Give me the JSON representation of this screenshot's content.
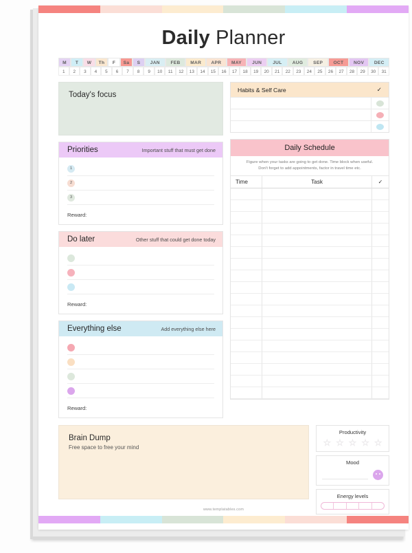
{
  "page": {
    "title_bold": "Daily",
    "title_light": " Planner",
    "footer": "www.templatables.com"
  },
  "decor": {
    "top_bar_colors": [
      "#f5837f",
      "#fbded6",
      "#fdecd0",
      "#d8e4d7",
      "#c8eef5",
      "#e2a9f5"
    ],
    "bottom_bar_colors": [
      "#e2a9f5",
      "#c8eef5",
      "#d8e4d7",
      "#fdecd0",
      "#fbded6",
      "#f5837f"
    ]
  },
  "datestrip": {
    "days": [
      {
        "label": "M",
        "color": "#e4d3f3"
      },
      {
        "label": "T",
        "color": "#cfeef6"
      },
      {
        "label": "W",
        "color": "#f9dde7"
      },
      {
        "label": "Th",
        "color": "#fae7cf"
      },
      {
        "label": "F",
        "color": "#ffffff"
      },
      {
        "label": "Sa",
        "color": "#f79891"
      },
      {
        "label": "S",
        "color": "#ddd0f2"
      }
    ],
    "months": [
      {
        "label": "JAN",
        "color": "#d9eef3"
      },
      {
        "label": "FEB",
        "color": "#dde9dd"
      },
      {
        "label": "MAR",
        "color": "#fbeacd"
      },
      {
        "label": "APR",
        "color": "#fae4d2"
      },
      {
        "label": "MAY",
        "color": "#f7b3b6"
      },
      {
        "label": "JUN",
        "color": "#eccef2"
      },
      {
        "label": "JUL",
        "color": "#d6eff5"
      },
      {
        "label": "AUG",
        "color": "#e0ecdf"
      },
      {
        "label": "SEP",
        "color": "#f6f0e3"
      },
      {
        "label": "OCT",
        "color": "#f69b95"
      },
      {
        "label": "NOV",
        "color": "#e3c6f2"
      },
      {
        "label": "DEC",
        "color": "#d4eef5"
      }
    ],
    "numbers": [
      1,
      2,
      3,
      4,
      5,
      6,
      7,
      8,
      9,
      10,
      11,
      12,
      13,
      14,
      15,
      16,
      17,
      18,
      19,
      20,
      21,
      22,
      23,
      24,
      25,
      26,
      27,
      28,
      29,
      30,
      31
    ]
  },
  "focus": {
    "title": "Today's focus",
    "bg": "#e2eae2"
  },
  "habits": {
    "title": "Habits & Self Care",
    "check_glyph": "✓",
    "header_bg": "#fbe6cb",
    "rows": [
      {
        "dot": "#d8e4d7"
      },
      {
        "dot": "#f5b0b7"
      },
      {
        "dot": "#bfe6f2"
      }
    ]
  },
  "priorities": {
    "title": "Priorities",
    "subtitle": "Important stuff that must get done",
    "header_bg": "#ecc9f7",
    "reward_label": "Reward:",
    "items": [
      {
        "num": "1",
        "dot": "#d5eaf2"
      },
      {
        "num": "2",
        "dot": "#f7ddd2"
      },
      {
        "num": "3",
        "dot": "#dfe8de"
      }
    ]
  },
  "do_later": {
    "title": "Do later",
    "subtitle": "Other stuff that could get done today",
    "header_bg": "#fbdcdc",
    "reward_label": "Reward:",
    "items": [
      {
        "dot": "#dce8dc"
      },
      {
        "dot": "#f6b2bc"
      },
      {
        "dot": "#c9e9f4"
      }
    ]
  },
  "everything_else": {
    "title": "Everything else",
    "subtitle": "Add everything else here",
    "header_bg": "#cfeaf3",
    "reward_label": "Reward:",
    "items": [
      {
        "dot": "#f5a8b2"
      },
      {
        "dot": "#fadfc2"
      },
      {
        "dot": "#dde8dc"
      },
      {
        "dot": "#dba6ec"
      }
    ]
  },
  "schedule": {
    "title": "Daily Schedule",
    "header_bg": "#f9c3cb",
    "note_line1": "Figure when your tasks are going to get done. Time block when useful.",
    "note_line2": "Don't forget to add appointments, factor in travel time etc.",
    "columns": [
      "Time",
      "Task",
      "✓"
    ],
    "row_count": 18
  },
  "brain_dump": {
    "title": "Brain Dump",
    "subtitle": "Free space to free your mind",
    "bg": "#fbefdd"
  },
  "widgets": {
    "productivity": {
      "label": "Productivity",
      "star_count": 5,
      "star_glyph": "☆"
    },
    "mood": {
      "label": "Mood",
      "face_color": "#dba6ec"
    },
    "energy": {
      "label": "Energy levels",
      "segments": 5,
      "outline": "#f0b8d8"
    }
  }
}
